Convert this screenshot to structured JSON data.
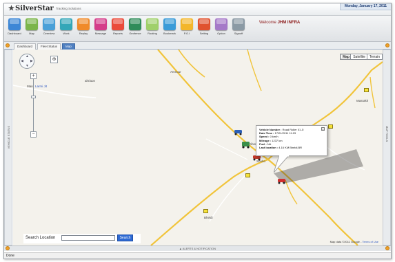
{
  "header": {
    "logo": "SilverStar",
    "tagline": "Tracking Solutions",
    "date": "Monday, January 17, 2011"
  },
  "toolbar": {
    "welcome_prefix": "Welcome",
    "welcome_user": "JHM INFRA",
    "items": [
      {
        "label": "Dashboard",
        "icon": "dashboard-icon",
        "color": "#3d87d6"
      },
      {
        "label": "Map",
        "icon": "map-icon",
        "color": "#7bb54a"
      },
      {
        "label": "Overview",
        "icon": "overview-icon",
        "color": "#4aa0d8"
      },
      {
        "label": "Work",
        "icon": "work-icon",
        "color": "#34a7b8"
      },
      {
        "label": "Replay",
        "icon": "replay-icon",
        "color": "#f08a2a"
      },
      {
        "label": "Message",
        "icon": "message-icon",
        "color": "#d43d8a"
      },
      {
        "label": "Reports",
        "icon": "reports-icon",
        "color": "#ea4b3b"
      },
      {
        "label": "Geofence",
        "icon": "geofence-icon",
        "color": "#2f8c5a"
      },
      {
        "label": "Routing",
        "icon": "routing-icon",
        "color": "#9fd06a"
      },
      {
        "label": "Bookmark",
        "icon": "bookmark-icon",
        "color": "#3a9bd8"
      },
      {
        "label": "P.O.I",
        "icon": "poi-icon",
        "color": "#f3b62b"
      },
      {
        "label": "Setting",
        "icon": "setting-icon",
        "color": "#e0522f"
      },
      {
        "label": "Option",
        "icon": "option-icon",
        "color": "#a579c8"
      },
      {
        "label": "Signoff",
        "icon": "signoff-icon",
        "color": "#8b9aa5"
      }
    ]
  },
  "tabs": [
    "Dashboard",
    "Fleet Status",
    "Map"
  ],
  "side": {
    "left": "VEHICLE STATUS",
    "right": "MAP TOOLS"
  },
  "map": {
    "types": [
      "Map",
      "Satellite",
      "Terrain"
    ],
    "places": [
      "Amnour",
      "ahriaon",
      "Man",
      "Larmi Jit",
      "Masrakh",
      "Tribeni",
      "Sonho",
      "Bheldi"
    ],
    "popup": {
      "vehicle_number_label": "Vehicle Number :",
      "vehicle_number": "Road Roller 01 JI",
      "datetime_label": "Date Time :",
      "datetime": "17/01/2011 11:29",
      "speed_label": "Speed :",
      "speed": "0 km/h",
      "mileage_label": "Mileage :",
      "mileage": "1237 km",
      "fuel_label": "Fuel :",
      "fuel": "NA",
      "location_label": "Last location :",
      "location": "4.16 KM Bheldi,BR",
      "close": "x"
    },
    "mapdata_text": "Map data ©2011 Google",
    "mapdata_link": "Terms of Use"
  },
  "search": {
    "label": "Search Location",
    "placeholder": "",
    "button": "Search"
  },
  "alerts": "▲ ALERTS & NOTIFICATION",
  "status": "Done",
  "colors": {
    "accent": "#4f7fc0",
    "road_major": "#f1c43a",
    "road_minor": "#ffffff"
  }
}
